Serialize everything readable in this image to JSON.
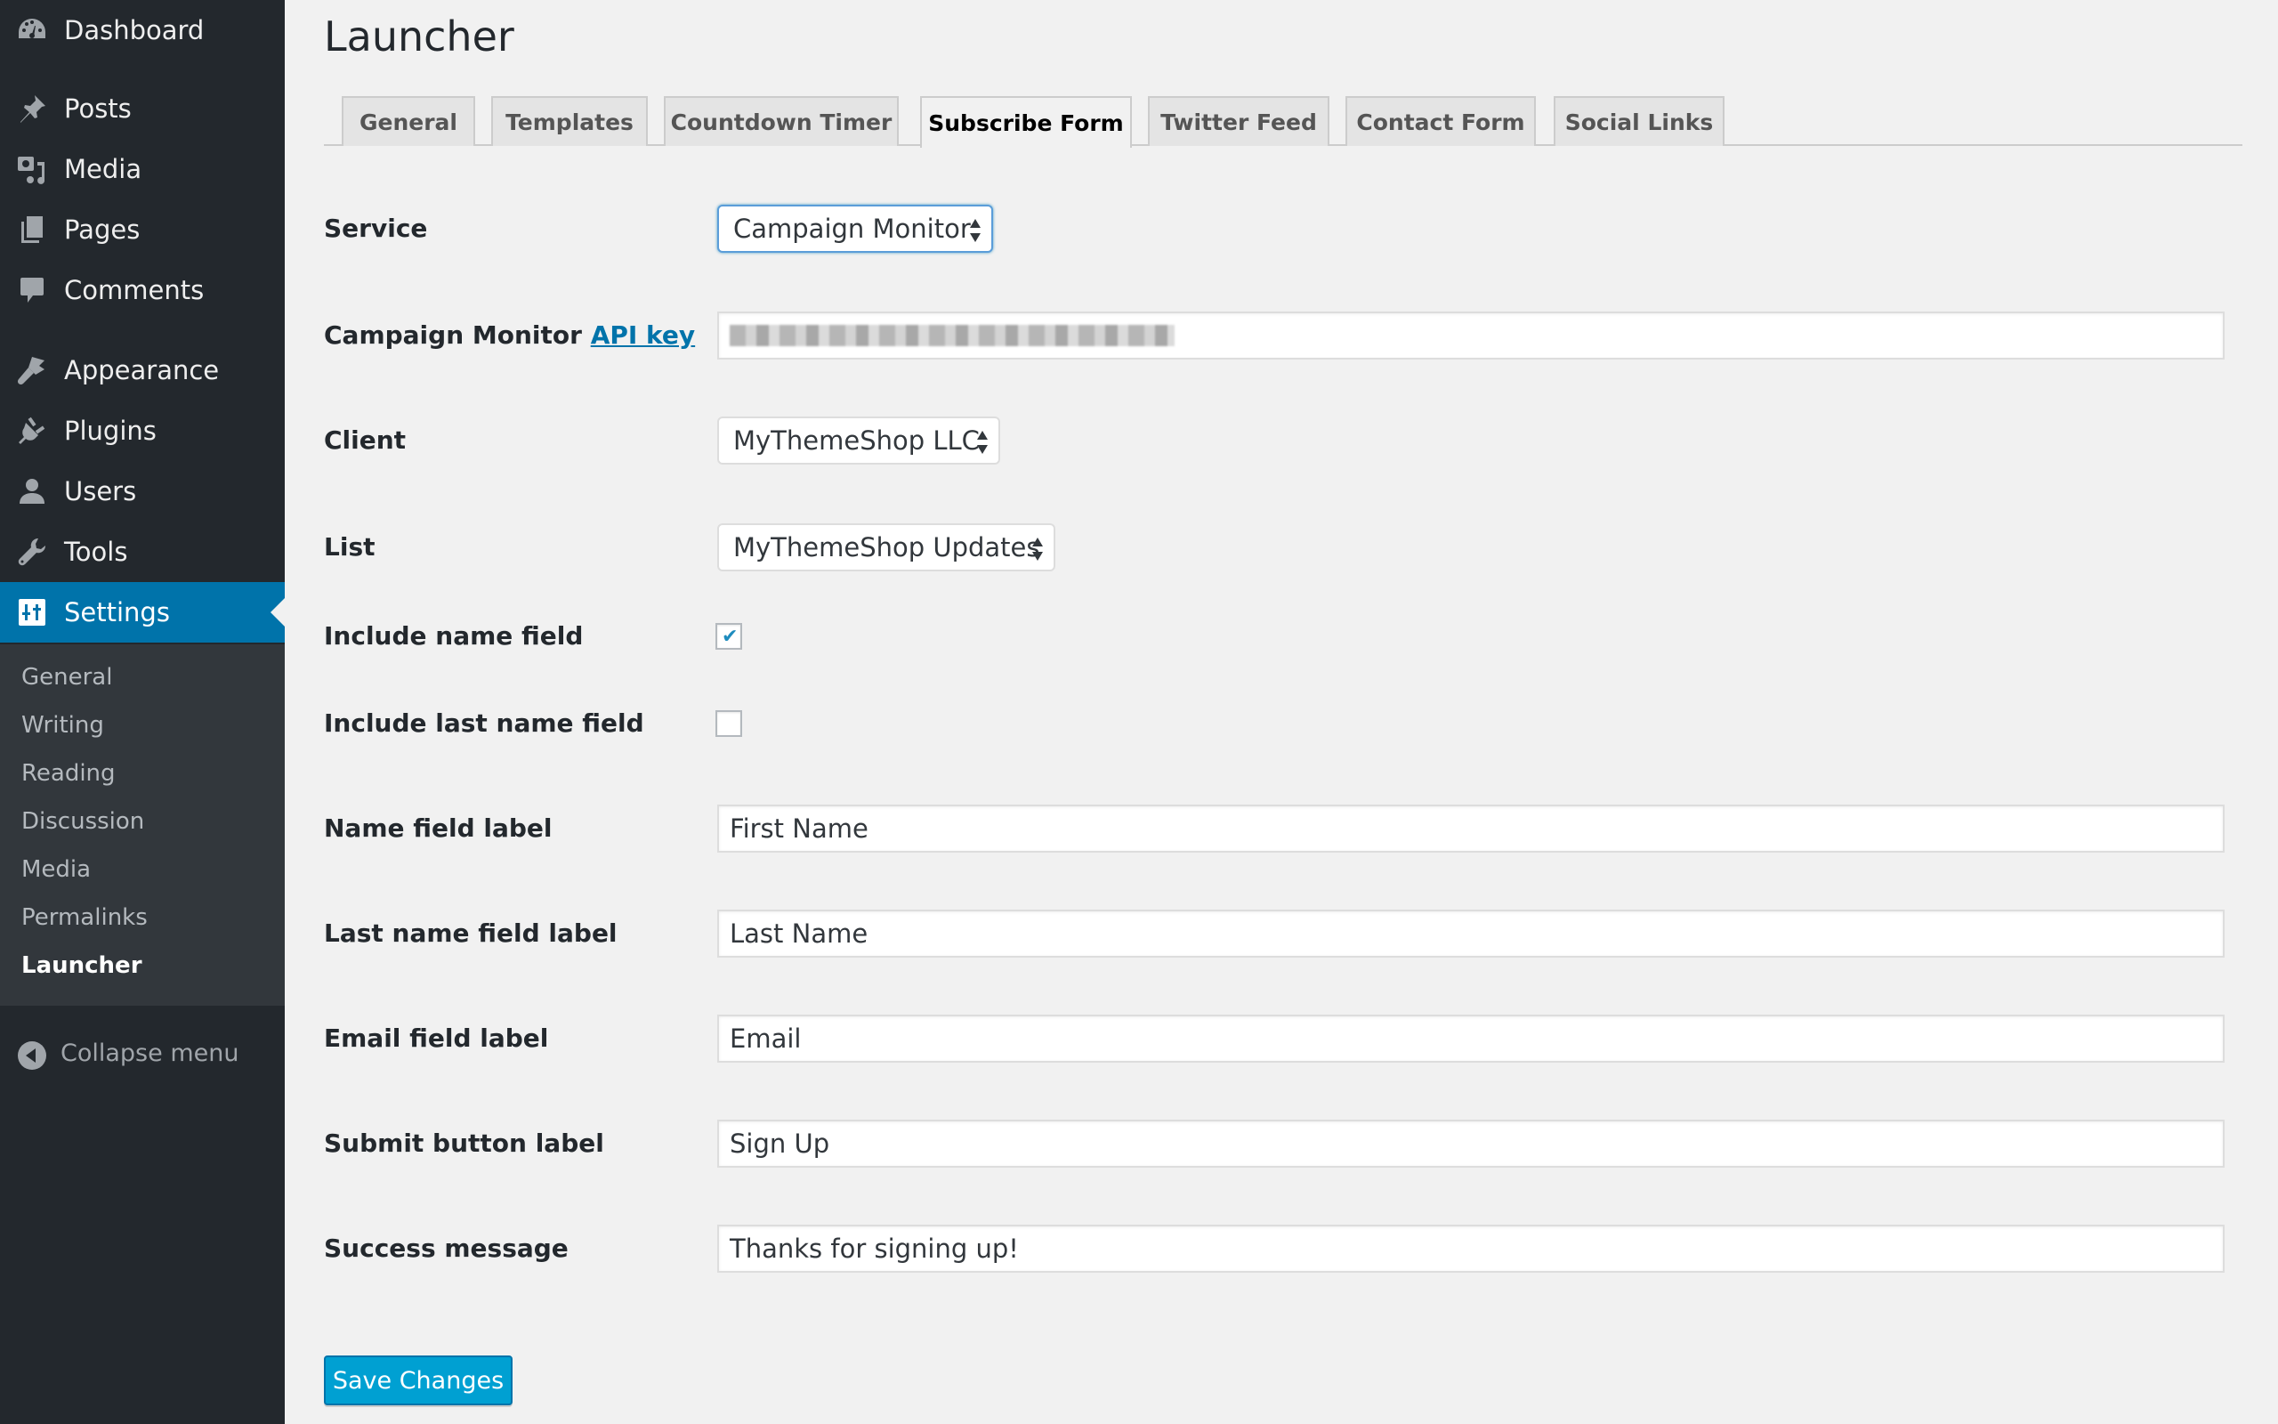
{
  "sidebar": {
    "items": [
      {
        "label": "Dashboard",
        "icon": "dashboard-icon"
      },
      {
        "label": "Posts",
        "icon": "pin-icon"
      },
      {
        "label": "Media",
        "icon": "media-icon"
      },
      {
        "label": "Pages",
        "icon": "pages-icon"
      },
      {
        "label": "Comments",
        "icon": "comment-icon"
      },
      {
        "label": "Appearance",
        "icon": "paintbrush-icon"
      },
      {
        "label": "Plugins",
        "icon": "plug-icon"
      },
      {
        "label": "Users",
        "icon": "user-icon"
      },
      {
        "label": "Tools",
        "icon": "wrench-icon"
      },
      {
        "label": "Settings",
        "icon": "settings-icon",
        "active": true
      }
    ],
    "submenu": [
      "General",
      "Writing",
      "Reading",
      "Discussion",
      "Media",
      "Permalinks",
      "Launcher"
    ],
    "submenu_current": "Launcher",
    "collapse_label": "Collapse menu"
  },
  "page": {
    "title": "Launcher",
    "tabs": [
      "General",
      "Templates",
      "Countdown Timer",
      "Subscribe Form",
      "Twitter Feed",
      "Contact Form",
      "Social Links"
    ],
    "active_tab": "Subscribe Form"
  },
  "form": {
    "service": {
      "label": "Service",
      "value": "Campaign Monitor"
    },
    "api_key": {
      "label_prefix": "Campaign Monitor ",
      "link_text": "API key",
      "value": "[redacted]"
    },
    "client": {
      "label": "Client",
      "value": "MyThemeShop LLC"
    },
    "list": {
      "label": "List",
      "value": "MyThemeShop Updates"
    },
    "include_name": {
      "label": "Include name field",
      "checked": true
    },
    "include_last_name": {
      "label": "Include last name field",
      "checked": false
    },
    "name_label": {
      "label": "Name field label",
      "value": "First Name"
    },
    "last_name_label": {
      "label": "Last name field label",
      "value": "Last Name"
    },
    "email_label": {
      "label": "Email field label",
      "value": "Email"
    },
    "submit_label": {
      "label": "Submit button label",
      "value": "Sign Up"
    },
    "success_message": {
      "label": "Success message",
      "value": "Thanks for signing up!"
    },
    "save_label": "Save Changes"
  },
  "colors": {
    "sidebar_bg": "#23282d",
    "submenu_bg": "#32373c",
    "accent": "#0073aa",
    "primary_button": "#00a0d2",
    "page_bg": "#f1f1f1"
  }
}
